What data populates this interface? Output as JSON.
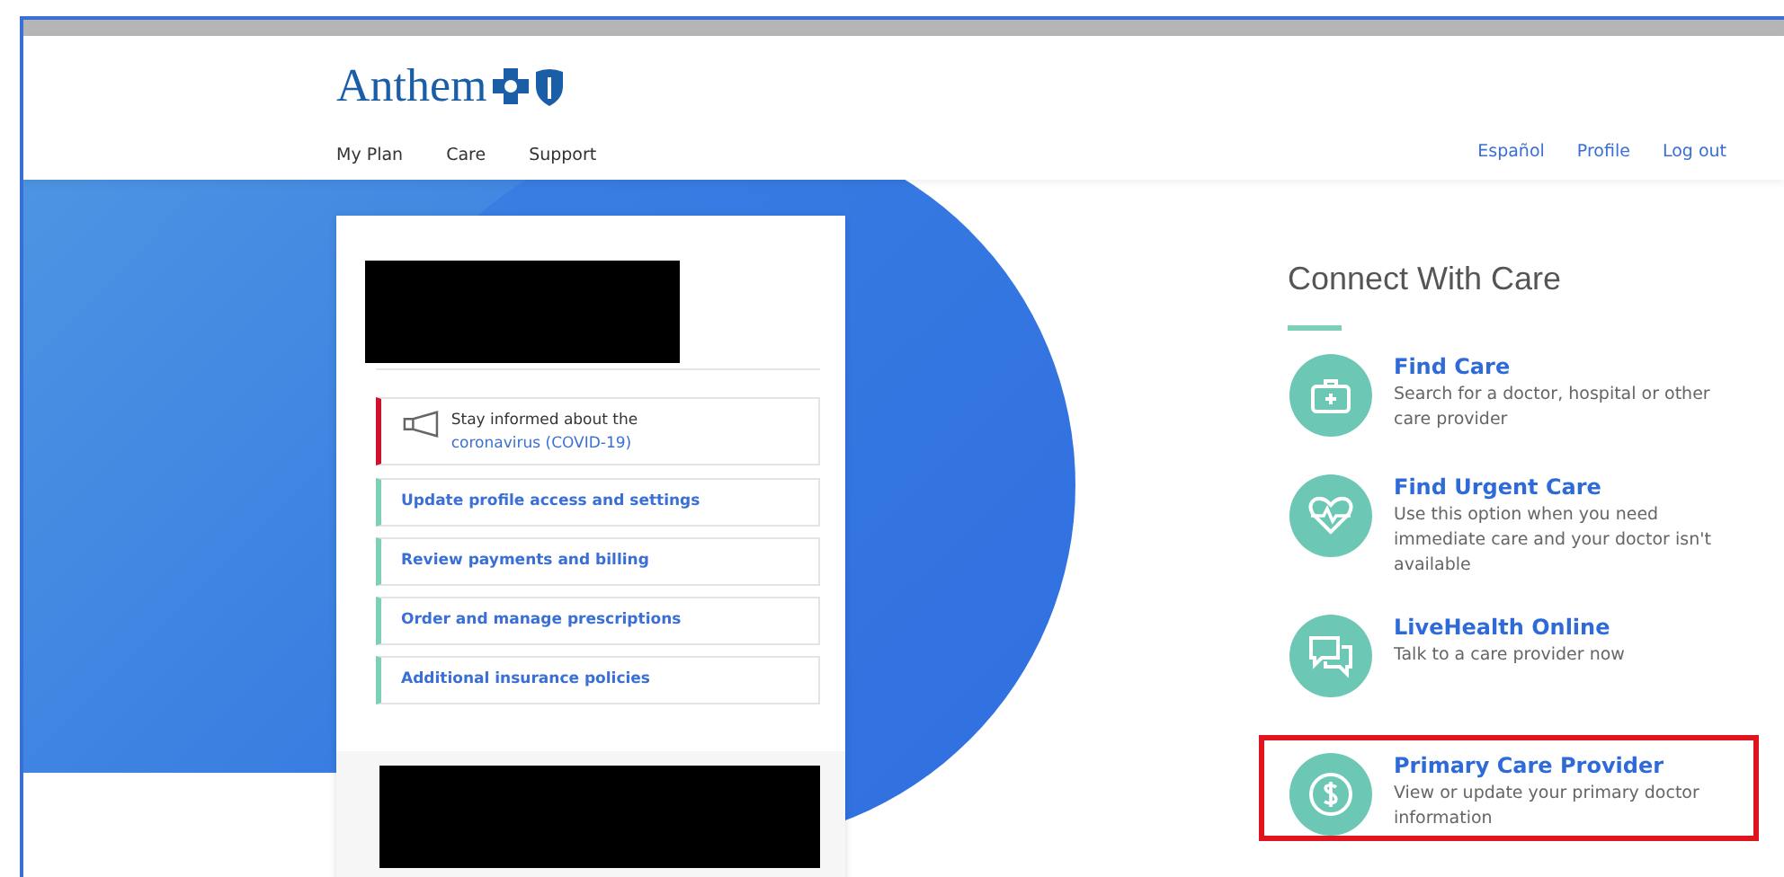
{
  "header": {
    "logo": "Anthem",
    "nav": [
      "My Plan",
      "Care",
      "Support"
    ],
    "utility_links": [
      "Español",
      "Profile",
      "Log out"
    ]
  },
  "account_card": {
    "alert": {
      "text": "Stay informed about the ",
      "link": "coronavirus (COVID-19)"
    },
    "links": [
      "Update profile access and settings",
      "Review payments and billing",
      "Order and manage prescriptions",
      "Additional insurance policies"
    ]
  },
  "connect": {
    "title": "Connect With Care",
    "options": [
      {
        "kind": "kit",
        "title": "Find Care",
        "description": "Search for a doctor, hospital or other care provider",
        "highlighted": false
      },
      {
        "kind": "heart",
        "title": "Find Urgent Care",
        "description": "Use this option when you need immediate care and your doctor isn't available",
        "highlighted": false
      },
      {
        "kind": "chat",
        "title": "LiveHealth Online",
        "description": "Talk to a care provider now",
        "highlighted": false
      },
      {
        "kind": "dollar",
        "title": "Primary Care Provider",
        "description": "View or update your primary doctor information",
        "highlighted": true
      }
    ]
  }
}
